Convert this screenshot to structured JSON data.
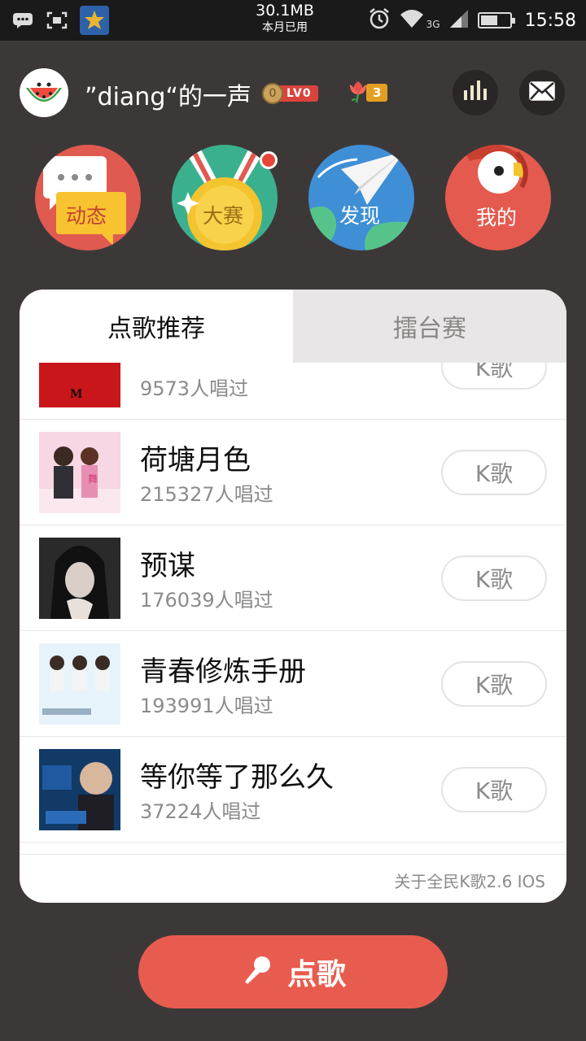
{
  "status_bar": {
    "data_usage": "30.1MB",
    "data_label": "本月已用",
    "network": "3G",
    "time": "15:58",
    "icons": [
      "message-icon",
      "screenshot-icon",
      "app-icon",
      "alarm-icon",
      "wifi-icon",
      "signal-icon",
      "battery-icon"
    ]
  },
  "header": {
    "username": "”diang“的一声",
    "coin_value": "0",
    "level": "LV0",
    "flower_count": "3"
  },
  "nav": {
    "items": [
      {
        "label": "动态",
        "icon": "chat-bubble-icon",
        "color": "#e05a50"
      },
      {
        "label": "大赛",
        "icon": "medal-icon",
        "color": "#3bb08f"
      },
      {
        "label": "发现",
        "icon": "paper-plane-icon",
        "color": "#3f8fd6"
      },
      {
        "label": "我的",
        "icon": "parrot-icon",
        "color": "#e55a4e"
      }
    ]
  },
  "tabs": [
    {
      "label": "点歌推荐",
      "active": true
    },
    {
      "label": "擂台赛",
      "active": false
    }
  ],
  "songs": [
    {
      "title": "",
      "count": "9573人唱过",
      "button": "K歌"
    },
    {
      "title": "荷塘月色",
      "count": "215327人唱过",
      "button": "K歌"
    },
    {
      "title": "预谋",
      "count": "176039人唱过",
      "button": "K歌"
    },
    {
      "title": "青春修炼手册",
      "count": "193991人唱过",
      "button": "K歌"
    },
    {
      "title": "等你等了那么久",
      "count": "37224人唱过",
      "button": "K歌"
    }
  ],
  "footer_note": "关于全民K歌2.6 IOS",
  "main_button": {
    "label": "点歌",
    "icon": "microphone-icon"
  },
  "colors": {
    "background": "#3d3838",
    "accent": "#e85c4f"
  }
}
